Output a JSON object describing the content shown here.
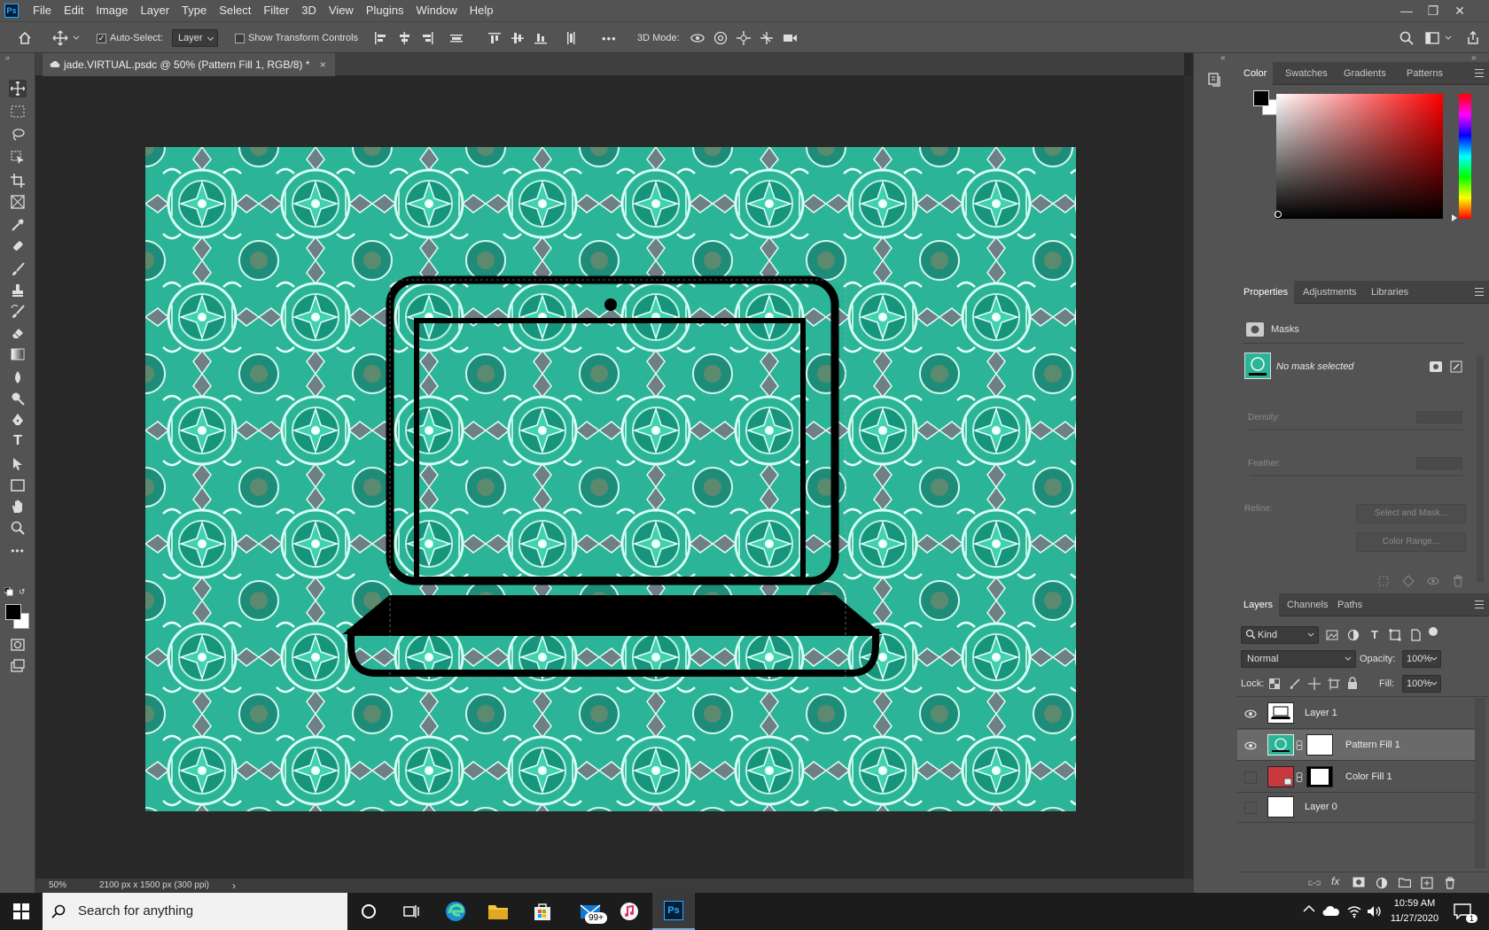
{
  "menubar": {
    "logo": "Ps",
    "items": [
      "File",
      "Edit",
      "Image",
      "Layer",
      "Type",
      "Select",
      "Filter",
      "3D",
      "View",
      "Plugins",
      "Window",
      "Help"
    ]
  },
  "options": {
    "auto_select_label": "Auto-Select:",
    "auto_select_checked": true,
    "auto_select_target": "Layer",
    "transform_controls_label": "Show Transform Controls",
    "more": "•••",
    "mode_3d_label": "3D Mode:"
  },
  "document": {
    "tab_title": "jade.VIRTUAL.psdc @ 50% (Pattern Fill 1, RGB/8) *",
    "close_glyph": "×"
  },
  "status": {
    "zoom": "50%",
    "doc_info": "2100 px x 1500 px (300 ppi)",
    "arrow": "›"
  },
  "color_panel": {
    "tabs": [
      "Color",
      "Swatches",
      "Gradients",
      "Patterns"
    ],
    "active_tab": "Color",
    "foreground": "#000000",
    "background": "#ffffff",
    "hue": "#ff0000"
  },
  "properties_panel": {
    "tabs": [
      "Properties",
      "Adjustments",
      "Libraries"
    ],
    "active_tab": "Properties",
    "section": "Masks",
    "mask_status": "No mask selected",
    "density_label": "Density:",
    "feather_label": "Feather:",
    "refine_label": "Refine:",
    "select_and_mask": "Select and Mask...",
    "color_range": "Color Range..."
  },
  "layers_panel": {
    "tabs": [
      "Layers",
      "Channels",
      "Paths"
    ],
    "active_tab": "Layers",
    "filter_kind": "Kind",
    "blend_mode": "Normal",
    "opacity_label": "Opacity:",
    "opacity": "100%",
    "lock_label": "Lock:",
    "fill_label": "Fill:",
    "fill": "100%",
    "layers": [
      {
        "name": "Layer 1",
        "visible": true,
        "selected": false
      },
      {
        "name": "Pattern Fill 1",
        "visible": true,
        "selected": true
      },
      {
        "name": "Color Fill 1",
        "visible": false,
        "selected": false
      },
      {
        "name": "Layer 0",
        "visible": false,
        "selected": false
      }
    ]
  },
  "taskbar": {
    "search_placeholder": "Search for anything",
    "mail_badge": "99+",
    "time": "10:59 AM",
    "date": "11/27/2020",
    "notification_count": "1"
  },
  "colors": {
    "pattern_teal": "#2fb39a",
    "color_fill_red": "#c8383c",
    "ps_blue": "#31a8ff"
  }
}
